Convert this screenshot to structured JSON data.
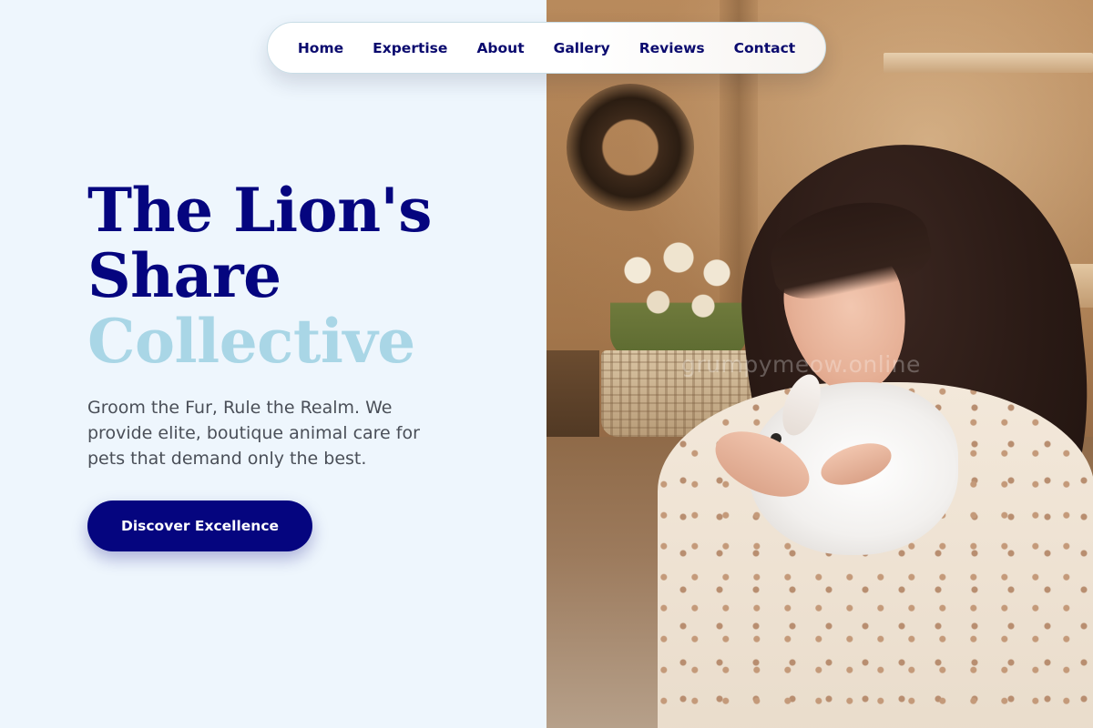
{
  "nav": {
    "links": [
      "Home",
      "Expertise",
      "About",
      "Gallery",
      "Reviews",
      "Contact"
    ]
  },
  "hero": {
    "title_line1": "The Lion's",
    "title_line2": "Share",
    "title_line3": "Collective",
    "subtitle": "Groom the Fur, Rule the Realm. We provide elite, boutique animal care for pets that demand only the best.",
    "cta_label": "Discover Excellence"
  },
  "photo": {
    "watermark": "grumpymeow.online"
  },
  "colors": {
    "primary": "#05057f",
    "accent_light": "#a9d6e6",
    "background": "#eef6fd",
    "body_text": "#4a4f58"
  }
}
